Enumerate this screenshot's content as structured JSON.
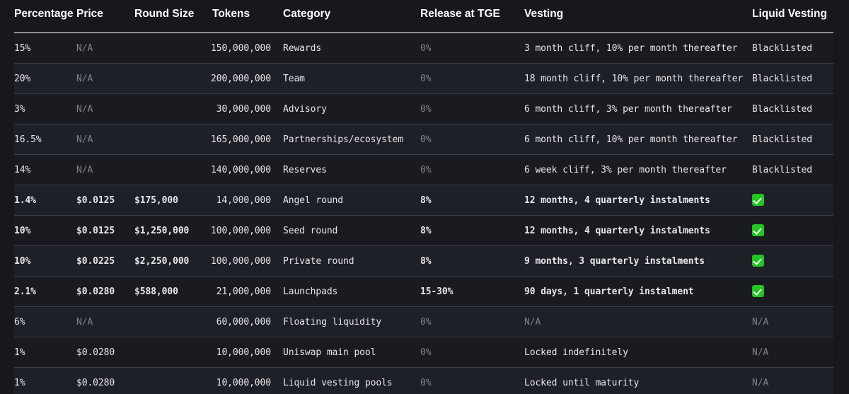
{
  "table": {
    "headers": [
      {
        "key": "percentage",
        "label": "Percentage"
      },
      {
        "key": "price",
        "label": "Price"
      },
      {
        "key": "round_size",
        "label": "Round Size"
      },
      {
        "key": "tokens",
        "label": "Tokens"
      },
      {
        "key": "category",
        "label": "Category"
      },
      {
        "key": "release_tge",
        "label": "Release at TGE"
      },
      {
        "key": "vesting",
        "label": "Vesting"
      },
      {
        "key": "liquid_vesting",
        "label": "Liquid Vesting"
      }
    ],
    "colors": {
      "page_background": "#17181d",
      "row_odd": "#1a1b21",
      "row_even": "#1e2027",
      "text": "#e6e6ea",
      "muted_text": "#7f8088",
      "divider": "#3a3c46",
      "header_rule": "#8e8f99",
      "check_green": "#22c522"
    },
    "rows": [
      {
        "percentage": "15%",
        "price": "N/A",
        "price_muted": true,
        "round_size": "",
        "tokens": "150,000,000",
        "category": "Rewards",
        "release_tge": "0%",
        "release_tge_muted": true,
        "vesting": "3 month cliff, 10% per month thereafter",
        "vesting_muted": false,
        "liquid_vesting": "Blacklisted",
        "liquid_vesting_muted": false,
        "liquid_vesting_icon": "",
        "emphasis": false
      },
      {
        "percentage": "20%",
        "price": "N/A",
        "price_muted": true,
        "round_size": "",
        "tokens": "200,000,000",
        "category": "Team",
        "release_tge": "0%",
        "release_tge_muted": true,
        "vesting": "18 month cliff, 10% per month thereafter",
        "vesting_muted": false,
        "liquid_vesting": "Blacklisted",
        "liquid_vesting_muted": false,
        "liquid_vesting_icon": "",
        "emphasis": false
      },
      {
        "percentage": "3%",
        "price": "N/A",
        "price_muted": true,
        "round_size": "",
        "tokens": "30,000,000",
        "category": "Advisory",
        "release_tge": "0%",
        "release_tge_muted": true,
        "vesting": "6 month cliff, 3% per month thereafter",
        "vesting_muted": false,
        "liquid_vesting": "Blacklisted",
        "liquid_vesting_muted": false,
        "liquid_vesting_icon": "",
        "emphasis": false
      },
      {
        "percentage": "16.5%",
        "price": "N/A",
        "price_muted": true,
        "round_size": "",
        "tokens": "165,000,000",
        "category": "Partnerships/ecosystem",
        "release_tge": "0%",
        "release_tge_muted": true,
        "vesting": "6 month cliff, 10% per month thereafter",
        "vesting_muted": false,
        "liquid_vesting": "Blacklisted",
        "liquid_vesting_muted": false,
        "liquid_vesting_icon": "",
        "emphasis": false
      },
      {
        "percentage": "14%",
        "price": "N/A",
        "price_muted": true,
        "round_size": "",
        "tokens": "140,000,000",
        "category": "Reserves",
        "release_tge": "0%",
        "release_tge_muted": true,
        "vesting": "6 week cliff, 3% per month thereafter",
        "vesting_muted": false,
        "liquid_vesting": "Blacklisted",
        "liquid_vesting_muted": false,
        "liquid_vesting_icon": "",
        "emphasis": false
      },
      {
        "percentage": "1.4%",
        "price": "$0.0125",
        "price_muted": false,
        "round_size": "$175,000",
        "tokens": "14,000,000",
        "category": "Angel round",
        "release_tge": "8%",
        "release_tge_muted": false,
        "vesting": "12 months, 4 quarterly instalments",
        "vesting_muted": false,
        "liquid_vesting": "",
        "liquid_vesting_muted": false,
        "liquid_vesting_icon": "check-mark-icon",
        "emphasis": true
      },
      {
        "percentage": "10%",
        "price": "$0.0125",
        "price_muted": false,
        "round_size": "$1,250,000",
        "tokens": "100,000,000",
        "category": "Seed round",
        "release_tge": "8%",
        "release_tge_muted": false,
        "vesting": "12 months, 4 quarterly instalments",
        "vesting_muted": false,
        "liquid_vesting": "",
        "liquid_vesting_muted": false,
        "liquid_vesting_icon": "check-mark-icon",
        "emphasis": true
      },
      {
        "percentage": "10%",
        "price": "$0.0225",
        "price_muted": false,
        "round_size": "$2,250,000",
        "tokens": "100,000,000",
        "category": "Private round",
        "release_tge": "8%",
        "release_tge_muted": false,
        "vesting": "9 months, 3 quarterly instalments",
        "vesting_muted": false,
        "liquid_vesting": "",
        "liquid_vesting_muted": false,
        "liquid_vesting_icon": "check-mark-icon",
        "emphasis": true
      },
      {
        "percentage": "2.1%",
        "price": "$0.0280",
        "price_muted": false,
        "round_size": "$588,000",
        "tokens": "21,000,000",
        "category": "Launchpads",
        "release_tge": "15-30%",
        "release_tge_muted": false,
        "vesting": "90 days, 1 quarterly instalment",
        "vesting_muted": false,
        "liquid_vesting": "",
        "liquid_vesting_muted": false,
        "liquid_vesting_icon": "check-mark-icon",
        "emphasis": true
      },
      {
        "percentage": "6%",
        "price": "N/A",
        "price_muted": true,
        "round_size": "",
        "tokens": "60,000,000",
        "category": "Floating liquidity",
        "release_tge": "0%",
        "release_tge_muted": true,
        "vesting": "N/A",
        "vesting_muted": true,
        "liquid_vesting": "N/A",
        "liquid_vesting_muted": true,
        "liquid_vesting_icon": "",
        "emphasis": false
      },
      {
        "percentage": "1%",
        "price": "$0.0280",
        "price_muted": false,
        "round_size": "",
        "tokens": "10,000,000",
        "category": "Uniswap main pool",
        "release_tge": "0%",
        "release_tge_muted": true,
        "vesting": "Locked indefinitely",
        "vesting_muted": false,
        "liquid_vesting": "N/A",
        "liquid_vesting_muted": true,
        "liquid_vesting_icon": "",
        "emphasis": false
      },
      {
        "percentage": "1%",
        "price": "$0.0280",
        "price_muted": false,
        "round_size": "",
        "tokens": "10,000,000",
        "category": "Liquid vesting pools",
        "release_tge": "0%",
        "release_tge_muted": true,
        "vesting": "Locked until maturity",
        "vesting_muted": false,
        "liquid_vesting": "N/A",
        "liquid_vesting_muted": true,
        "liquid_vesting_icon": "",
        "emphasis": false
      }
    ]
  }
}
